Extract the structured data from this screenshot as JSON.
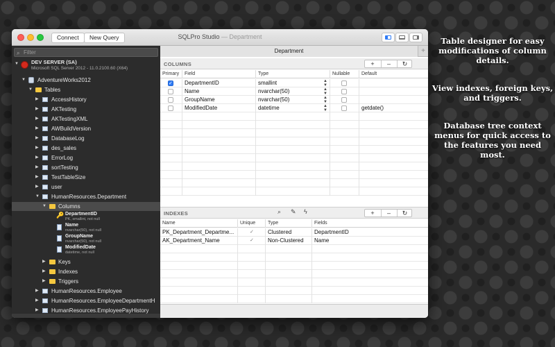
{
  "window": {
    "title": "SQLPro Studio",
    "title_separator": " — ",
    "subtitle": "Department",
    "connect_label": "Connect",
    "new_query_label": "New Query"
  },
  "sidebar": {
    "filter_placeholder": "Filter",
    "server_name": "DEV SERVER (SA)",
    "server_version": "Microsoft SQL Server 2012 - 11.0.2100.60 (X64)",
    "database": "AdventureWorks2012",
    "tables_folder": "Tables",
    "tables": [
      "AccessHistory",
      "AKTesting",
      "AKTestingXML",
      "AWBuildVersion",
      "DatabaseLog",
      "des_sales",
      "ErrorLog",
      "sortTesting",
      "TestTableSize",
      "user"
    ],
    "expanded_table": "HumanResources.Department",
    "columns_folder": "Columns",
    "columns": [
      {
        "name": "DepartmentID",
        "desc": "PK, smallint, not null",
        "is_key": true
      },
      {
        "name": "Name",
        "desc": "nvarchar(50), not null",
        "is_key": false
      },
      {
        "name": "GroupName",
        "desc": "nvarchar(50), not null",
        "is_key": false
      },
      {
        "name": "ModifiedDate",
        "desc": "datetime, not null",
        "is_key": false
      }
    ],
    "subfolders": [
      "Keys",
      "Indexes",
      "Triggers"
    ],
    "more_tables": [
      "HumanResources.Employee",
      "HumanResources.EmployeeDepartmentH",
      "HumanResources.EmployeePayHistory"
    ]
  },
  "main": {
    "tab_label": "Department",
    "columns_section": {
      "title": "COLUMNS",
      "headers": [
        "Primary",
        "Field",
        "Type",
        "Nullable",
        "Default"
      ],
      "rows": [
        {
          "primary": true,
          "field": "DepartmentID",
          "type": "smallint",
          "nullable": false,
          "default": ""
        },
        {
          "primary": false,
          "field": "Name",
          "type": "nvarchar(50)",
          "nullable": false,
          "default": ""
        },
        {
          "primary": false,
          "field": "GroupName",
          "type": "nvarchar(50)",
          "nullable": false,
          "default": ""
        },
        {
          "primary": false,
          "field": "ModifiedDate",
          "type": "datetime",
          "nullable": false,
          "default": "getdate()"
        }
      ]
    },
    "indexes_section": {
      "title": "INDEXES",
      "headers": [
        "Name",
        "Unique",
        "Type",
        "Fields"
      ],
      "rows": [
        {
          "name": "PK_Department_Departme...",
          "unique": true,
          "type": "Clustered",
          "fields": "DepartmentID"
        },
        {
          "name": "AK_Department_Name",
          "unique": true,
          "type": "Non-Clustered",
          "fields": "Name"
        }
      ]
    },
    "segment_labels": {
      "add": "+",
      "remove": "–",
      "refresh": "↻"
    }
  },
  "captions": [
    "Table designer for easy modifications of column details.",
    "View indexes, foreign keys, and triggers.",
    "Database tree context menus for quick access to the features you need most."
  ],
  "colors": {
    "accent": "#2f7bf5",
    "sidebar_bg": "#2c2c2c",
    "folder": "#f4c73f",
    "server": "#d42a1d"
  }
}
